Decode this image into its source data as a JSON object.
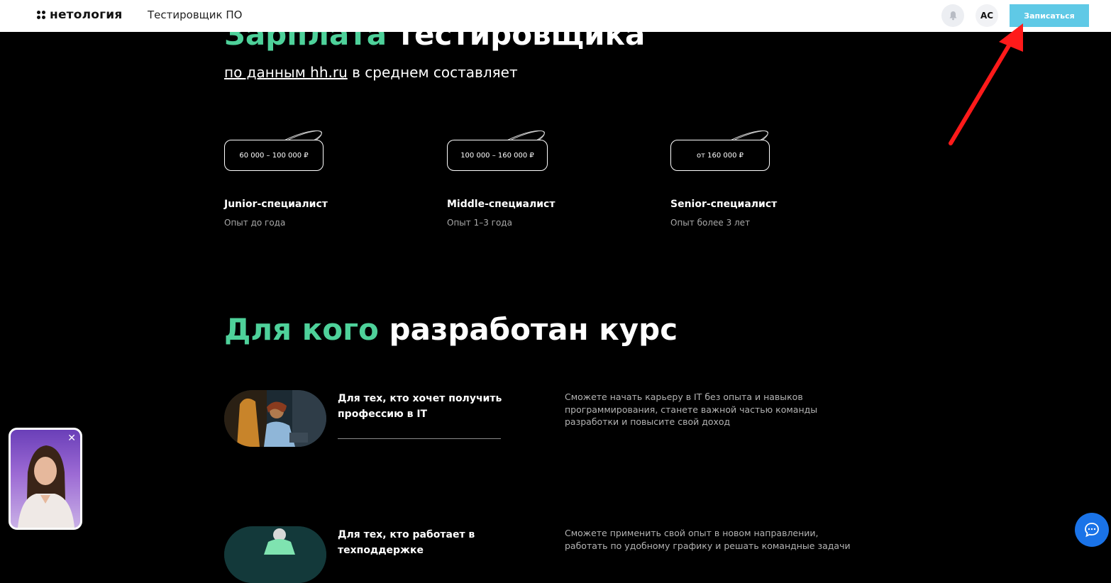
{
  "header": {
    "logo_text": "нетология",
    "course_name": "Тестировщик ПО",
    "avatar_initials": "АС",
    "signup_label": "Записаться"
  },
  "salary": {
    "title_accent": "Зарплата",
    "title_rest": " тестировщика",
    "subtitle_link": "по данным hh.ru",
    "subtitle_rest": " в среднем составляет",
    "levels": [
      {
        "range": "60 000 – 100 000 ₽",
        "name": "Junior-специалист",
        "experience": "Опыт до года"
      },
      {
        "range": "100 000 – 160 000 ₽",
        "name": "Middle-специалист",
        "experience": "Опыт 1–3 года"
      },
      {
        "range": "от 160 000 ₽",
        "name": "Senior-специалист",
        "experience": "Опыт более 3 лет"
      }
    ]
  },
  "audience": {
    "title_accent": "Для кого",
    "title_rest": " разработан курс",
    "items": [
      {
        "title": "Для тех, кто хочет получить профессию в IT",
        "description": "Сможете начать карьеру в IT без опыта и навыков программирования, станете важной частью команды разработки и повысите свой доход"
      },
      {
        "title": "Для тех, кто работает в техподдержке",
        "description": "Сможете применить свой опыт в новом направлении, работать по удобному графику и решать командные задачи"
      }
    ]
  },
  "colors": {
    "accent": "#4ed19a",
    "button": "#5fc9e6",
    "chat": "#1a73e8",
    "annotation_arrow": "#ff1a1a"
  }
}
